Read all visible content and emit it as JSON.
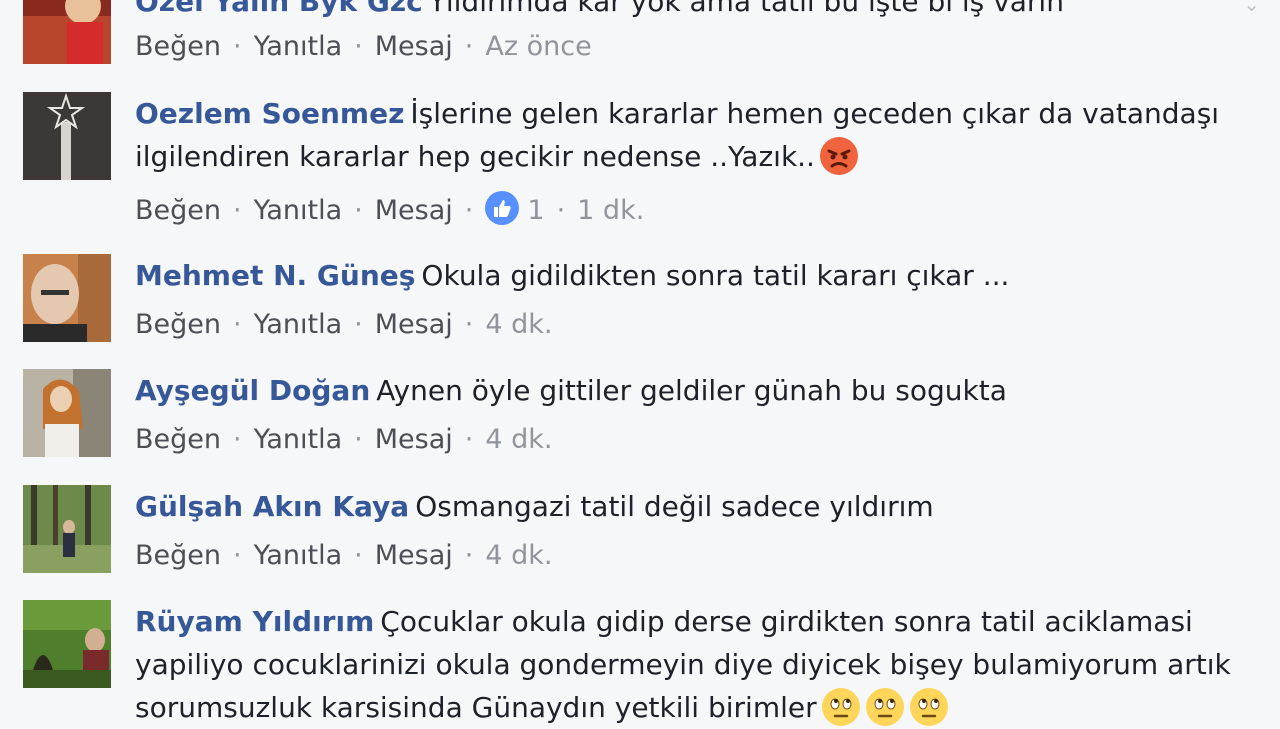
{
  "actions": {
    "like": "Beğen",
    "reply": "Yanıtla",
    "message": "Mesaj",
    "sep": "·"
  },
  "comments": [
    {
      "author": "Özel Yalın Byk Gzc",
      "text": "Yıldırımda kar yok ama tatil bu işte bi iş varın",
      "time": "Az önce",
      "likes": "",
      "avatar_color": "#c0392b"
    },
    {
      "author": "Oezlem Soenmez",
      "text": "İşlerine gelen kararlar hemen geceden çıkar da vatandaşı ilgilendiren kararlar hep gecikir nedense ..Yazık..",
      "time": "1 dk.",
      "likes": "1",
      "emoji": "angry-face",
      "avatar_color": "#3a3535"
    },
    {
      "author": "Mehmet N. Güneş",
      "text": "Okula gidildikten sonra tatil kararı çıkar ...",
      "time": "4 dk.",
      "likes": "",
      "avatar_color": "#c97a3f"
    },
    {
      "author": "Ayşegül Doğan",
      "text": "Aynen öyle gittiler geldiler günah bu sogukta",
      "time": "4 dk.",
      "likes": "",
      "avatar_color": "#b8a07a"
    },
    {
      "author": "Gülşah Akın Kaya",
      "text": "Osmangazi tatil değil sadece yıldırım",
      "time": "4 dk.",
      "likes": "",
      "avatar_color": "#5a7d3a"
    },
    {
      "author": "Rüyam Yıldırım",
      "text": "Çocuklar okula gidip derse girdikten sonra tatil aciklamasi yapiliyo cocuklarinizi okula gondermeyin diye diyicek bişey bulamiyorum artık sorumsuzluk karsisinda Günaydın yetkili birimler",
      "time": "",
      "likes": "",
      "emoji": "rolling-eyes-face",
      "avatar_color": "#4a7a2a"
    }
  ]
}
